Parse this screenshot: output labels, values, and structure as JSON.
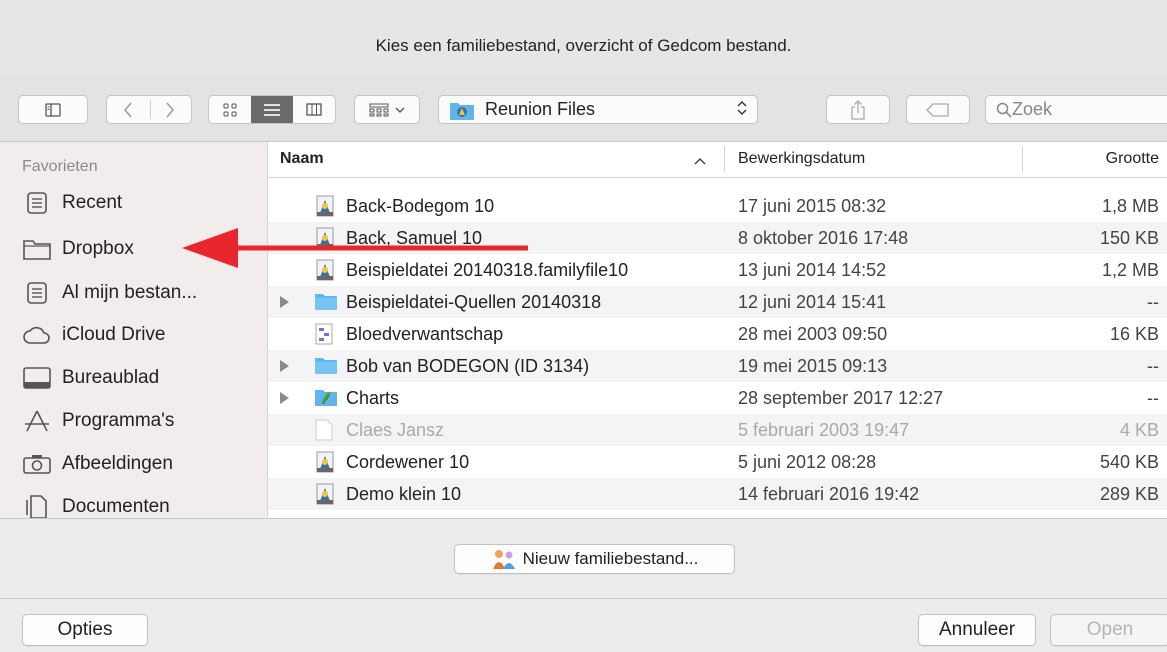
{
  "window": {
    "title": "Kies een familiebestand, overzicht of Gedcom bestand."
  },
  "toolbar": {
    "location": "Reunion Files",
    "search_placeholder": "Zoek"
  },
  "sidebar": {
    "heading": "Favorieten",
    "items": [
      {
        "label": "Recent",
        "icon": "recent-icon"
      },
      {
        "label": "Dropbox",
        "icon": "folder-icon"
      },
      {
        "label": "Al mijn bestan...",
        "icon": "all-files-icon"
      },
      {
        "label": "iCloud Drive",
        "icon": "cloud-icon"
      },
      {
        "label": "Bureaublad",
        "icon": "desktop-icon"
      },
      {
        "label": "Programma's",
        "icon": "applications-icon"
      },
      {
        "label": "Afbeeldingen",
        "icon": "camera-icon"
      },
      {
        "label": "Documenten",
        "icon": "documents-icon"
      }
    ]
  },
  "columns": {
    "name": "Naam",
    "date": "Bewerkingsdatum",
    "size": "Grootte"
  },
  "files": [
    {
      "name": "Back-Bodegom 10",
      "date": "17 juni 2015 08:32",
      "size": "1,8 MB",
      "kind": "family",
      "folder": false,
      "dim": false
    },
    {
      "name": "Back, Samuel 10",
      "date": "8 oktober 2016 17:48",
      "size": "150 KB",
      "kind": "family",
      "folder": false,
      "dim": false
    },
    {
      "name": "Beispieldatei 20140318.familyfile10",
      "date": "13 juni 2014 14:52",
      "size": "1,2 MB",
      "kind": "family",
      "folder": false,
      "dim": false
    },
    {
      "name": "Beispieldatei-Quellen 20140318",
      "date": "12 juni 2014 15:41",
      "size": "--",
      "kind": "folder",
      "folder": true,
      "dim": false
    },
    {
      "name": "Bloedverwantschap",
      "date": "28 mei 2003 09:50",
      "size": "16 KB",
      "kind": "chart",
      "folder": false,
      "dim": false
    },
    {
      "name": "Bob van BODEGON (ID 3134)",
      "date": "19 mei 2015 09:13",
      "size": "--",
      "kind": "folder",
      "folder": true,
      "dim": false
    },
    {
      "name": "Charts",
      "date": "28 september 2017 12:27",
      "size": "--",
      "kind": "charts-folder",
      "folder": true,
      "dim": false
    },
    {
      "name": "Claes Jansz",
      "date": "5 februari 2003 19:47",
      "size": "4 KB",
      "kind": "doc",
      "folder": false,
      "dim": true
    },
    {
      "name": "Cordewener 10",
      "date": "5 juni 2012 08:28",
      "size": "540 KB",
      "kind": "family",
      "folder": false,
      "dim": false
    },
    {
      "name": "Demo klein 10",
      "date": "14 februari 2016 19:42",
      "size": "289 KB",
      "kind": "family",
      "folder": false,
      "dim": false
    }
  ],
  "accessory": {
    "new_family_file": "Nieuw familiebestand..."
  },
  "buttons": {
    "options": "Opties",
    "cancel": "Annuleer",
    "open": "Open"
  },
  "colors": {
    "arrow": "#e8262b",
    "folder": "#5fb5ec",
    "sidebar_bg": "#f3ecec"
  }
}
